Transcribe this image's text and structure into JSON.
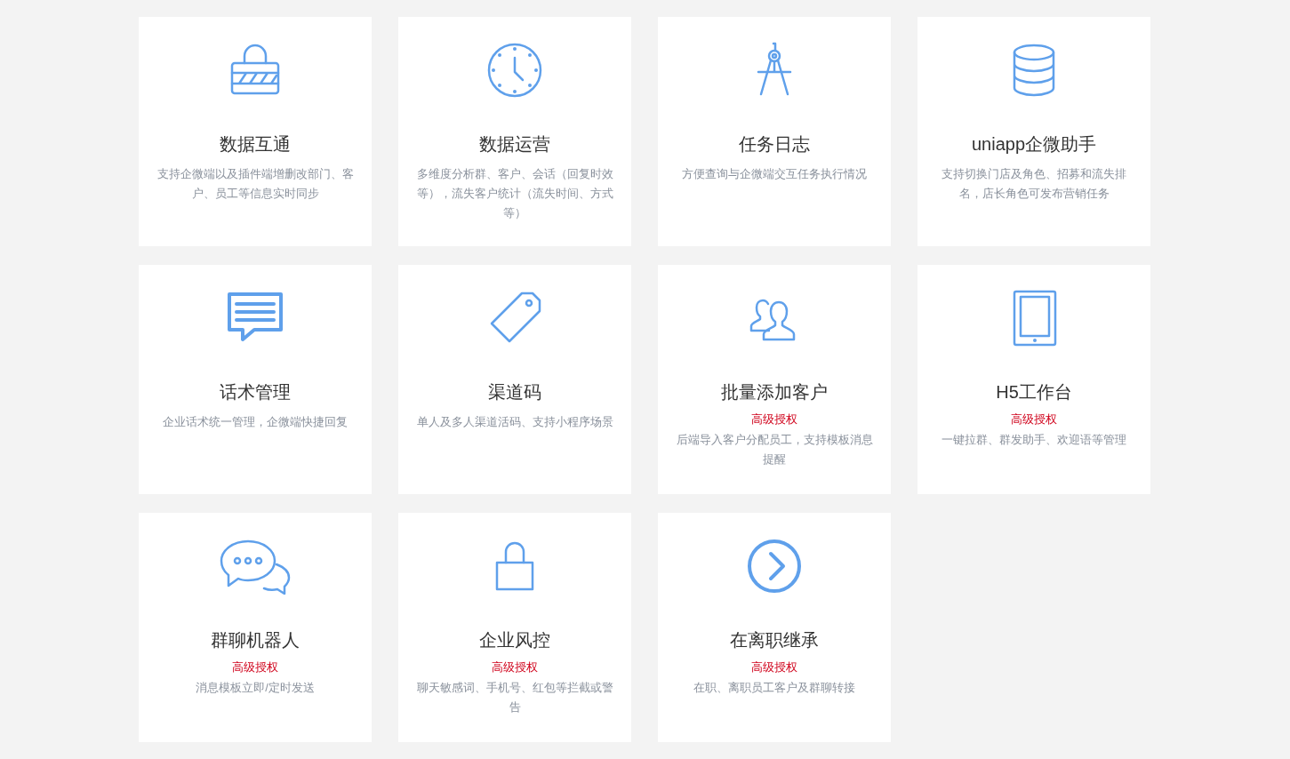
{
  "features": [
    {
      "kind": "lock-striped",
      "title": "数据互通",
      "description": "支持企微端以及插件端增删改部门、客户、员工等信息实时同步"
    },
    {
      "kind": "clock",
      "title": "数据运营",
      "description": "多维度分析群、客户、会话（回复时效等），流失客户统计（流失时间、方式等）"
    },
    {
      "kind": "compass",
      "title": "任务日志",
      "description": "方便查询与企微端交互任务执行情况"
    },
    {
      "kind": "database",
      "title": "uniapp企微助手",
      "description": "支持切换门店及角色、招募和流失排名，店长角色可发布营销任务"
    },
    {
      "kind": "message",
      "title": "话术管理",
      "description": "企业话术统一管理，企微端快捷回复"
    },
    {
      "kind": "tag",
      "title": "渠道码",
      "description": "单人及多人渠道活码、支持小程序场景"
    },
    {
      "kind": "users",
      "title": "批量添加客户",
      "badge": "高级授权",
      "description": "后端导入客户分配员工，支持模板消息提醒"
    },
    {
      "kind": "tablet",
      "title": "H5工作台",
      "badge": "高级授权",
      "description": "一键拉群、群发助手、欢迎语等管理"
    },
    {
      "kind": "chat",
      "title": "群聊机器人",
      "badge": "高级授权",
      "description": "消息模板立即/定时发送"
    },
    {
      "kind": "lock",
      "title": "企业风控",
      "badge": "高级授权",
      "description": "聊天敏感词、手机号、红包等拦截或警告"
    },
    {
      "kind": "chevron-circle",
      "title": "在离职继承",
      "badge": "高级授权",
      "description": "在职、离职员工客户及群聊转接"
    }
  ]
}
